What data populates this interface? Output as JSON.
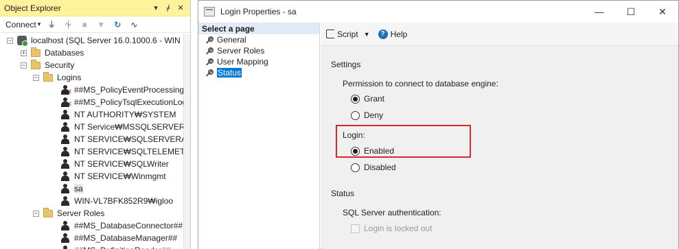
{
  "object_explorer": {
    "title": "Object Explorer",
    "title_buttons": [
      "▾",
      "ᚋ",
      "✕"
    ],
    "connect_label": "Connect",
    "tree": [
      {
        "label": "localhost (SQL Server 16.0.1000.6 - WIN",
        "icon": "server-icon",
        "exp": "⊟",
        "level": 0,
        "kind": "server"
      },
      {
        "label": "Databases",
        "icon": "folder-icon",
        "exp": "+",
        "level": 1,
        "kind": "folder"
      },
      {
        "label": "Security",
        "icon": "folder-icon",
        "exp": "−",
        "level": 1,
        "kind": "folder"
      },
      {
        "label": "Logins",
        "icon": "folder-icon",
        "exp": "−",
        "level": 2,
        "kind": "folder"
      },
      {
        "label": "##MS_PolicyEventProcessingLo",
        "icon": "login-disabled-icon",
        "level": 3,
        "kind": "userx"
      },
      {
        "label": "##MS_PolicyTsqlExecutionLog",
        "icon": "login-disabled-icon",
        "level": 3,
        "kind": "userx"
      },
      {
        "label": "NT AUTHORITY₩SYSTEM",
        "icon": "login-icon",
        "level": 3,
        "kind": "user"
      },
      {
        "label": "NT Service₩MSSQLSERVER",
        "icon": "login-icon",
        "level": 3,
        "kind": "user"
      },
      {
        "label": "NT SERVICE₩SQLSERVERAGEN",
        "icon": "login-icon",
        "level": 3,
        "kind": "user"
      },
      {
        "label": "NT SERVICE₩SQLTELEMETRY",
        "icon": "login-icon",
        "level": 3,
        "kind": "user"
      },
      {
        "label": "NT SERVICE₩SQLWriter",
        "icon": "login-icon",
        "level": 3,
        "kind": "user"
      },
      {
        "label": "NT SERVICE₩Winmgmt",
        "icon": "login-icon",
        "level": 3,
        "kind": "user"
      },
      {
        "label": "sa",
        "icon": "login-icon",
        "level": 3,
        "kind": "user",
        "selected": true
      },
      {
        "label": "WIN-VL7BFK852R9₩igloo",
        "icon": "login-icon",
        "level": 3,
        "kind": "user"
      },
      {
        "label": "Server Roles",
        "icon": "folder-icon",
        "exp": "−",
        "level": 2,
        "kind": "folder"
      },
      {
        "label": "##MS_DatabaseConnector##",
        "icon": "role-icon",
        "level": 3,
        "kind": "user"
      },
      {
        "label": "##MS_DatabaseManager##",
        "icon": "role-icon",
        "level": 3,
        "kind": "user"
      },
      {
        "label": "##MS_DefinitionReader##",
        "icon": "role-icon",
        "level": 3,
        "kind": "user"
      }
    ]
  },
  "dialog": {
    "title": "Login Properties - sa",
    "select_page_header": "Select a page",
    "pages": [
      "General",
      "Server Roles",
      "User Mapping",
      "Status"
    ],
    "active_page": "Status",
    "toolbar": {
      "script_label": "Script",
      "help_label": "Help"
    },
    "settings_header": "Settings",
    "permission_label": "Permission to connect to database engine:",
    "permission_options": [
      "Grant",
      "Deny"
    ],
    "permission_selected": "Grant",
    "login_label": "Login:",
    "login_options": [
      "Enabled",
      "Disabled"
    ],
    "login_selected": "Enabled",
    "status_header": "Status",
    "sql_auth_label": "SQL Server authentication:",
    "locked_out_label": "Login is locked out",
    "highlight_color": "#d6262e"
  }
}
